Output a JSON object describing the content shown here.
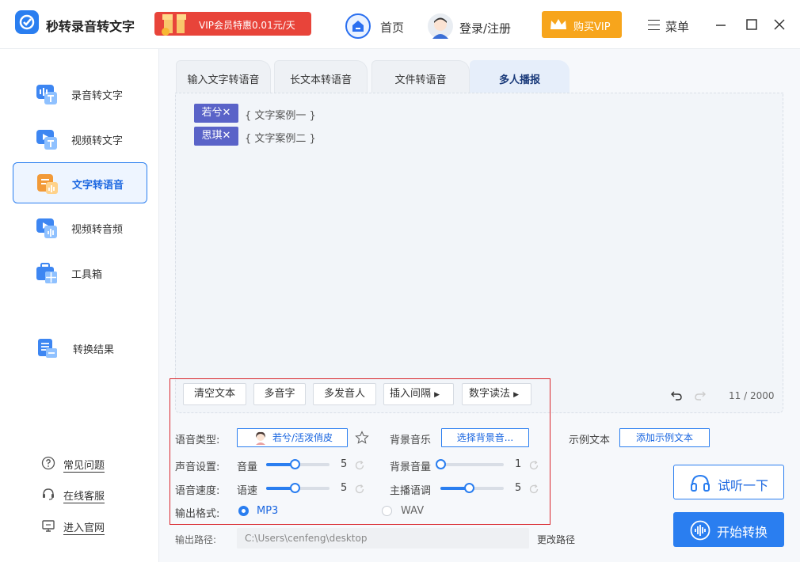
{
  "app": {
    "name": "秒转录音转文字"
  },
  "promo": {
    "text": "VIP会员特惠0.01元/天"
  },
  "nav": {
    "home": "首页",
    "login": "登录/注册",
    "buy_vip": "购买VIP",
    "menu": "菜单"
  },
  "sidebar": {
    "items": [
      {
        "label": "录音转文字",
        "icon": "audio-to-text-icon"
      },
      {
        "label": "视频转文字",
        "icon": "video-to-text-icon"
      },
      {
        "label": "文字转语音",
        "icon": "text-to-speech-icon",
        "active": true
      },
      {
        "label": "视频转音频",
        "icon": "video-to-audio-icon"
      },
      {
        "label": "工具箱",
        "icon": "toolbox-icon"
      },
      {
        "label": "转换结果",
        "icon": "results-icon"
      }
    ],
    "footer": [
      {
        "label": "常见问题",
        "icon": "question-icon"
      },
      {
        "label": "在线客服",
        "icon": "headset-icon"
      },
      {
        "label": "进入官网",
        "icon": "monitor-icon"
      }
    ]
  },
  "tabs": [
    {
      "label": "输入文字转语音"
    },
    {
      "label": "长文本转语音"
    },
    {
      "label": "文件转语音"
    },
    {
      "label": "多人播报",
      "active": true
    }
  ],
  "editor": {
    "lines": [
      {
        "speaker": "若兮",
        "text": "{ 文字案例一 }"
      },
      {
        "speaker": "思琪",
        "text": "{ 文字案例二 }"
      }
    ],
    "toolbar": {
      "clear": "清空文本",
      "polyphone": "多音字",
      "multi_speaker": "多发音人",
      "insert_pause": "插入间隔",
      "number_reading": "数字读法"
    },
    "char_count": "11 / 2000"
  },
  "settings": {
    "voice_type_label": "语音类型:",
    "voice_value": "若兮/活泼俏皮",
    "bg_music_label": "背景音乐",
    "bg_music_button": "选择背景音...",
    "sample_text_label": "示例文本",
    "sample_text_button": "添加示例文本",
    "sound_label": "声音设置:",
    "volume_label": "音量",
    "volume_value": "5",
    "volume_level": 0.45,
    "bg_volume_label": "背景音量",
    "bg_volume_value": "1",
    "bg_volume_level": 0.0,
    "speed_row_label": "语音速度:",
    "speed_label": "语速",
    "speed_value": "5",
    "speed_level": 0.45,
    "pitch_label": "主播语调",
    "pitch_value": "5",
    "pitch_level": 0.45,
    "format_label": "输出格式:",
    "format_mp3": "MP3",
    "format_wav": "WAV",
    "selected_format": "MP3",
    "path_label": "输出路径:",
    "path_value": "C:\\Users\\cenfeng\\desktop",
    "change_path": "更改路径"
  },
  "actions": {
    "preview": "试听一下",
    "start": "开始转换"
  },
  "colors": {
    "accent": "#2a7ef0",
    "tag": "#5a63c8",
    "vip": "#f7a51c",
    "promo": "#e8443a",
    "highlight_box": "#d9262c"
  }
}
